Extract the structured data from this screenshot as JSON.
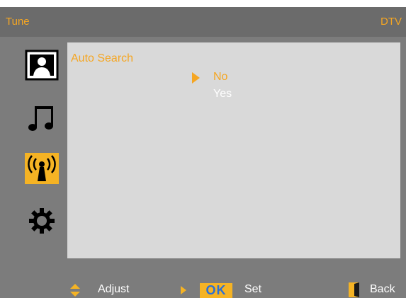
{
  "header": {
    "title": "Tune",
    "source": "DTV"
  },
  "sidebar": {
    "items": [
      {
        "name": "picture",
        "icon": "picture-icon"
      },
      {
        "name": "sound",
        "icon": "music-note-icon"
      },
      {
        "name": "tune",
        "icon": "antenna-icon",
        "selected": true
      },
      {
        "name": "setup",
        "icon": "gear-icon"
      }
    ]
  },
  "menu": {
    "label": "Auto Search",
    "options": [
      "No",
      "Yes"
    ],
    "selected": "No"
  },
  "footer": {
    "adjust_label": "Adjust",
    "ok_label": "OK",
    "set_label": "Set",
    "back_label": "Back"
  },
  "colors": {
    "accent": "#f5a623",
    "background": "#7c7c7c",
    "panel": "#d9d9d9",
    "ok_text": "#2a6fd6"
  }
}
